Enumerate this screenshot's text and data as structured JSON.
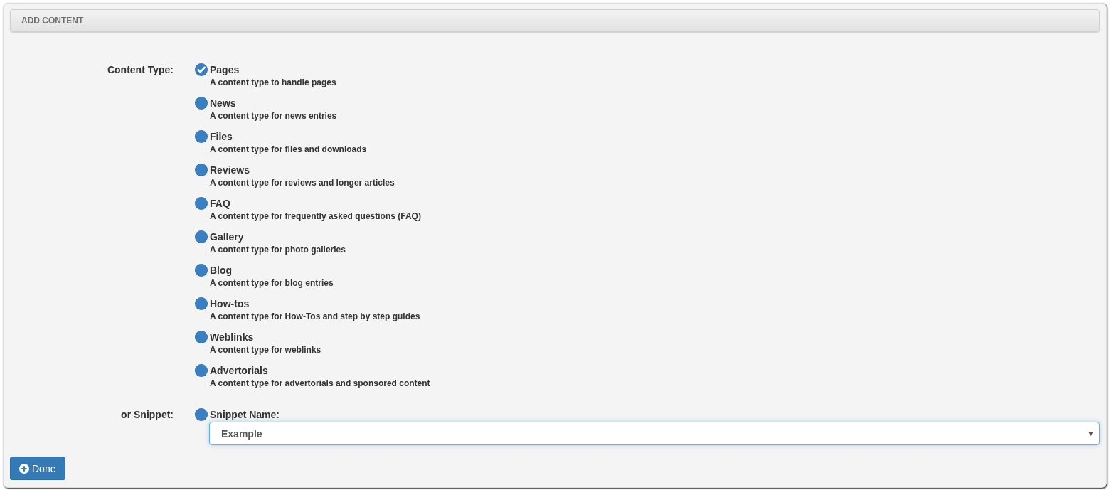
{
  "panel": {
    "title": "ADD CONTENT"
  },
  "content_type": {
    "label": "Content Type:",
    "options": [
      {
        "title": "Pages",
        "description": "A content type to handle pages",
        "selected": true
      },
      {
        "title": "News",
        "description": "A content type for news entries",
        "selected": false
      },
      {
        "title": "Files",
        "description": "A content type for files and downloads",
        "selected": false
      },
      {
        "title": "Reviews",
        "description": "A content type for reviews and longer articles",
        "selected": false
      },
      {
        "title": "FAQ",
        "description": "A content type for frequently asked questions (FAQ)",
        "selected": false
      },
      {
        "title": "Gallery",
        "description": "A content type for photo galleries",
        "selected": false
      },
      {
        "title": "Blog",
        "description": "A content type for blog entries",
        "selected": false
      },
      {
        "title": "How-tos",
        "description": "A content type for How-Tos and step by step guides",
        "selected": false
      },
      {
        "title": "Weblinks",
        "description": "A content type for weblinks",
        "selected": false
      },
      {
        "title": "Advertorials",
        "description": "A content type for advertorials and sponsored content",
        "selected": false
      }
    ]
  },
  "snippet": {
    "label": "or Snippet:",
    "option_label": "Snippet Name:",
    "selected": false,
    "select_value": "Example"
  },
  "done_button": {
    "label": "Done"
  }
}
